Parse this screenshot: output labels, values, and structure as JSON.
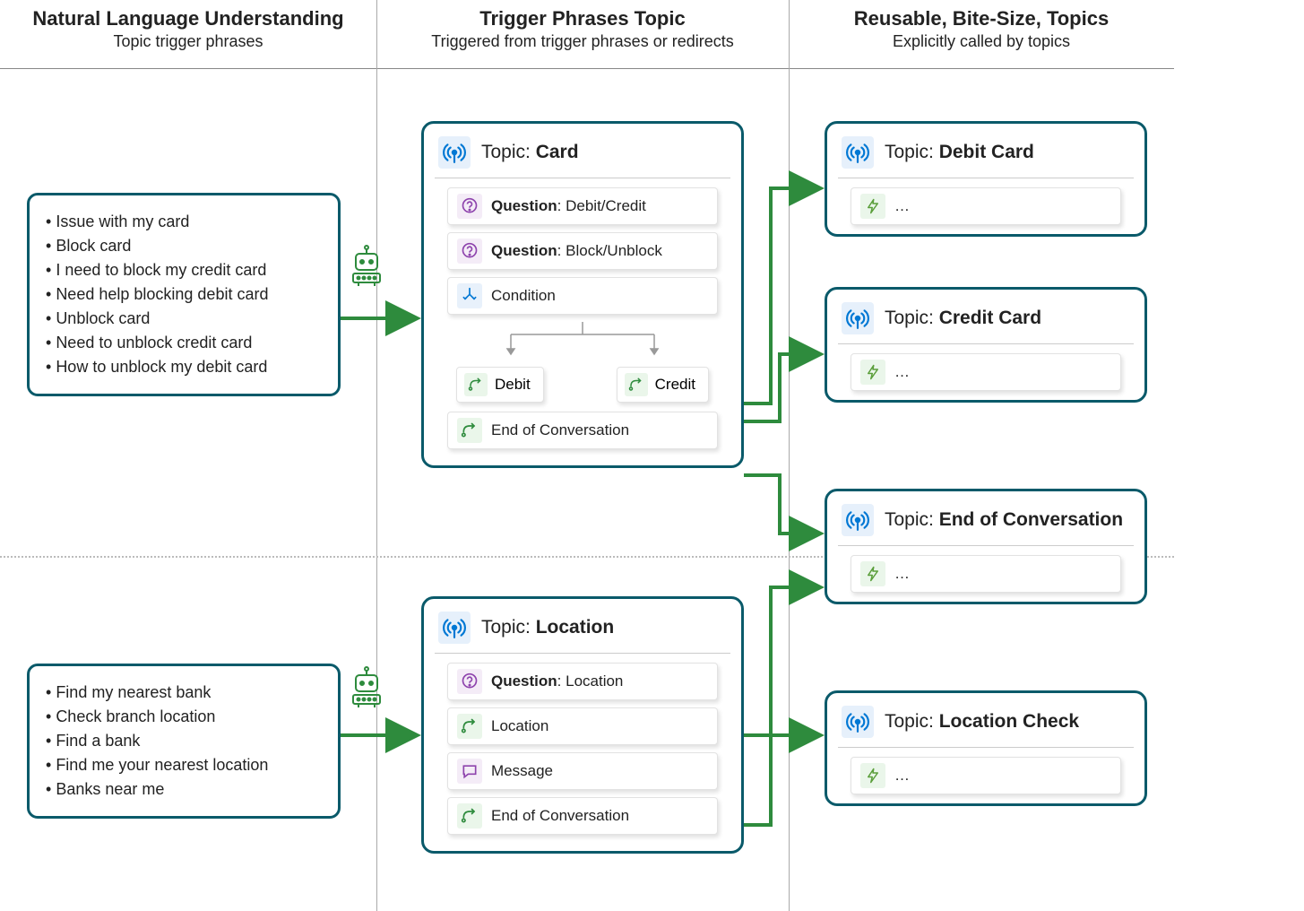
{
  "columns": {
    "col1": {
      "title": "Natural Language Understanding",
      "subtitle": "Topic trigger phrases"
    },
    "col2": {
      "title": "Trigger Phrases Topic",
      "subtitle": "Triggered from trigger phrases or redirects"
    },
    "col3": {
      "title": "Reusable, Bite-Size, Topics",
      "subtitle": "Explicitly called by topics"
    }
  },
  "phrases": {
    "card": {
      "items": [
        "Issue with my card",
        "Block card",
        "I need to block my credit card",
        "Need help blocking debit card",
        "Unblock card",
        "Need to unblock credit card",
        "How to unblock my debit card"
      ]
    },
    "location": {
      "items": [
        "Find my nearest bank",
        "Check branch location",
        "Find a bank",
        "Find me your nearest location",
        "Banks near me"
      ]
    }
  },
  "topics": {
    "card": {
      "prefix": "Topic: ",
      "name": "Card",
      "q1_prefix": "Question",
      "q1_rest": ": Debit/Credit",
      "q2_prefix": "Question",
      "q2_rest": ": Block/Unblock",
      "condition": "Condition",
      "branch_debit": "Debit",
      "branch_credit": "Credit",
      "end": "End of Conversation"
    },
    "location": {
      "prefix": "Topic: ",
      "name": "Location",
      "q1_prefix": "Question",
      "q1_rest": ": Location",
      "redirect": "Location",
      "message": "Message",
      "end": "End of Conversation"
    }
  },
  "mini": {
    "debit": {
      "prefix": "Topic: ",
      "name": "Debit Card",
      "ellipsis": "…"
    },
    "credit": {
      "prefix": "Topic: ",
      "name": "Credit Card",
      "ellipsis": "…"
    },
    "eoc": {
      "prefix": "Topic: ",
      "name": "End of Conversation",
      "ellipsis": "…"
    },
    "loccheck": {
      "prefix": "Topic: ",
      "name": "Location Check",
      "ellipsis": "…"
    }
  }
}
